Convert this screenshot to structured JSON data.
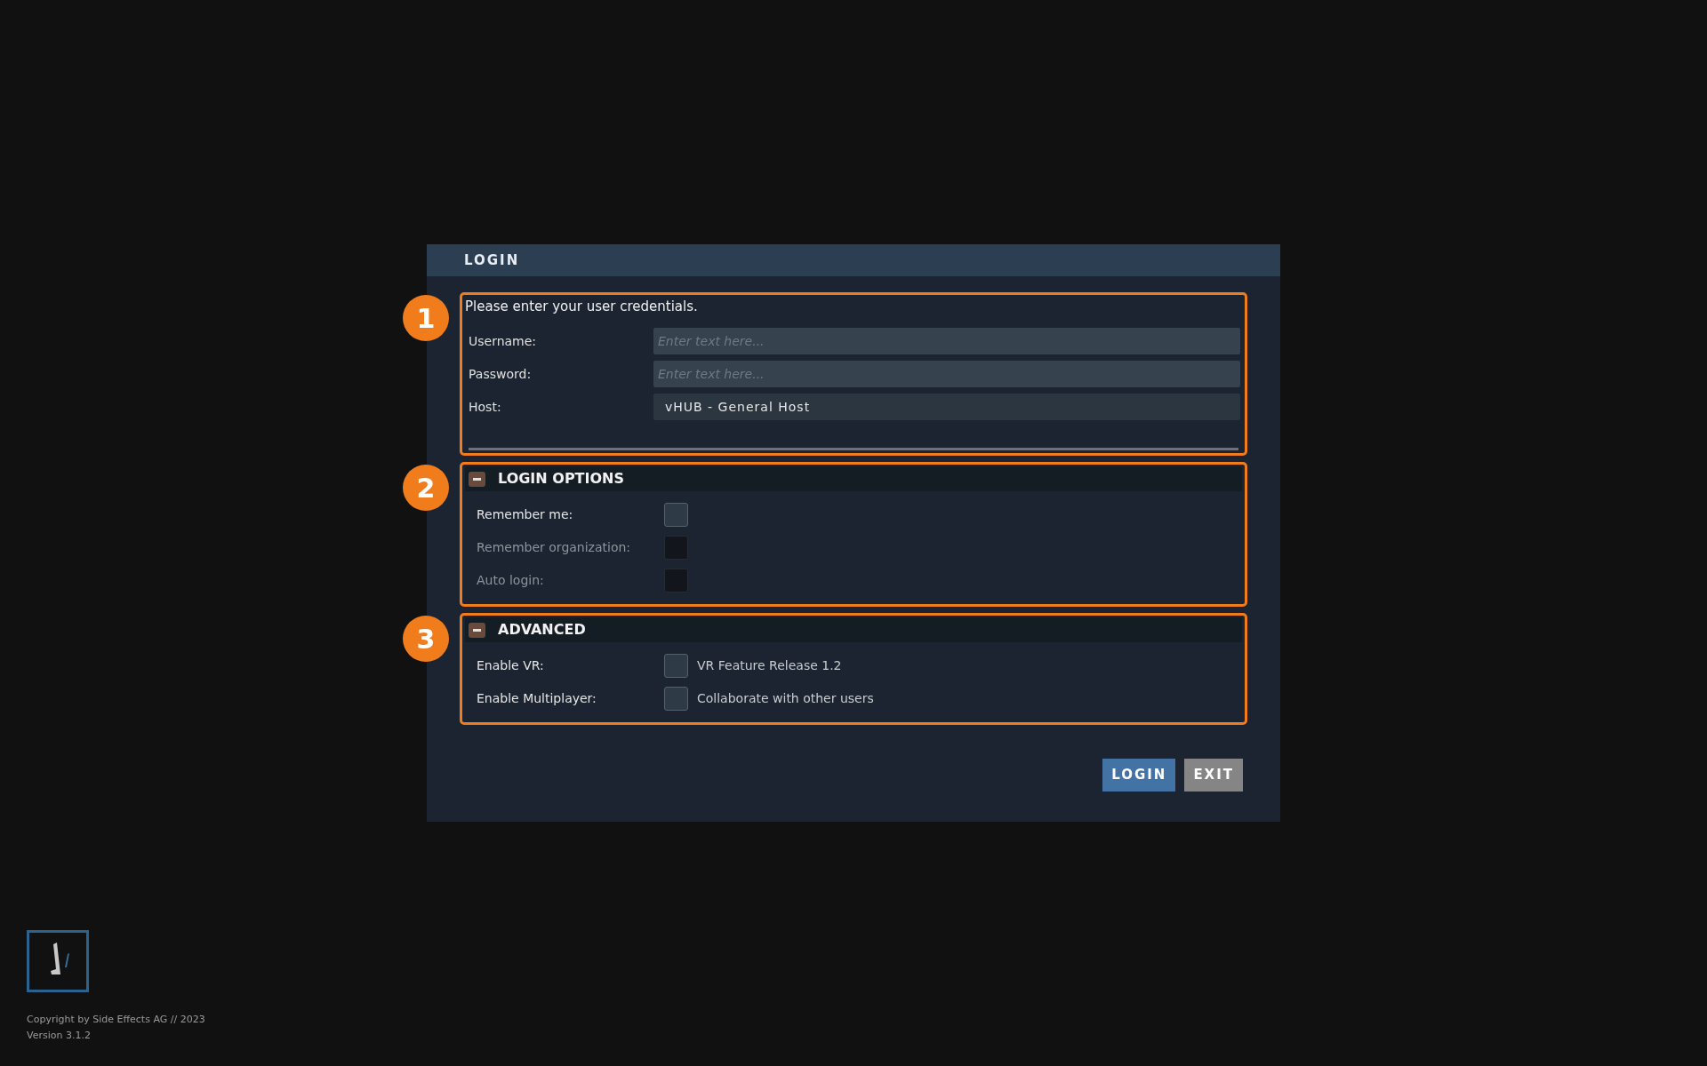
{
  "dialog": {
    "title": "LOGIN",
    "credentials": {
      "badge": "1",
      "intro": "Please enter your user credentials.",
      "fields": [
        {
          "label": "Username:",
          "placeholder": "Enter text here..."
        },
        {
          "label": "Password:",
          "placeholder": "Enter text here..."
        },
        {
          "label": "Host:",
          "value": "vHUB - General Host"
        }
      ]
    },
    "sections": [
      {
        "badge": "2",
        "title": "LOGIN OPTIONS",
        "expanded": true,
        "options": [
          {
            "label": "Remember me:",
            "checked": false,
            "disabled": false
          },
          {
            "label": "Remember organization:",
            "checked": false,
            "disabled": true
          },
          {
            "label": "Auto login:",
            "checked": false,
            "disabled": true
          }
        ]
      },
      {
        "badge": "3",
        "title": "ADVANCED",
        "expanded": true,
        "options": [
          {
            "label": "Enable VR:",
            "checked": false,
            "disabled": false,
            "caption": "VR Feature Release 1.2"
          },
          {
            "label": "Enable Multiplayer:",
            "checked": false,
            "disabled": false,
            "caption": "Collaborate with other users"
          }
        ]
      }
    ],
    "buttons": [
      {
        "label": "LOGIN",
        "kind": "primary"
      },
      {
        "label": "EXIT",
        "kind": "secondary"
      }
    ]
  },
  "footer": {
    "copyright": "Copyright by Side Effects AG // 2023",
    "version": "Version 3.1.2"
  }
}
